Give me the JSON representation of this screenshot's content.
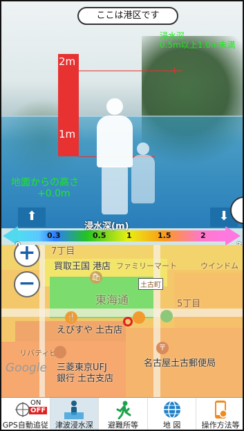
{
  "ar_view": {
    "location_pill": "ここは港区です",
    "flood_info_line1": "浸水深",
    "flood_info_line2": "0.5m以上1.0m未満",
    "height_2m": "2m",
    "height_1m": "1m",
    "ground_label": "地面からの高さ",
    "ground_value": "+0.0m"
  },
  "depth_scale": {
    "title": "浸水深(m)",
    "ticks": [
      "0.3",
      "0.5",
      "1",
      "1.5",
      "2"
    ],
    "start_label": "0",
    "end_label": "3",
    "colors": [
      "#4fdcf2",
      "#2d7dff",
      "#22c322",
      "#e9ef13",
      "#fb9b19",
      "#ff78e0"
    ]
  },
  "map": {
    "labels": {
      "shop": "買取王国 港店",
      "mart": "ファミリーマート",
      "window": "ウインドム",
      "street": "東海通",
      "block": "5丁目",
      "block2": "7丁目",
      "tosho": "土古町",
      "ebisuya": "えびすや 土古店",
      "post": "名古屋土古郵便局",
      "bank1": "三菱東京UFJ",
      "bank2": "銀行 土古支店",
      "liberty": "リバティビル",
      "google": "Google"
    },
    "zoom_in": "+",
    "zoom_out": "−"
  },
  "toolbar": {
    "items": [
      {
        "label": "GPS自動追従",
        "on_text": "ON",
        "off_text": "OFF"
      },
      {
        "label": "津波浸水深"
      },
      {
        "label": "避難所等"
      },
      {
        "label": "地 図"
      },
      {
        "label": "操作方法等"
      }
    ]
  }
}
